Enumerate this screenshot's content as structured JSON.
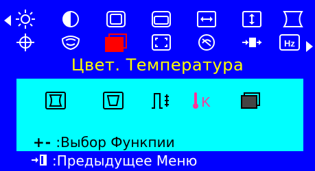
{
  "menu": {
    "row1_icons": [
      "brightness-icon",
      "contrast-icon",
      "h-size-icon",
      "v-size-icon",
      "h-position-icon",
      "v-position-icon",
      "pincushion-icon"
    ],
    "row2_icons": [
      "rotation-icon",
      "moire-icon",
      "color-temperature-icon",
      "zoom-icon",
      "degauss-icon",
      "input-source-icon",
      "frequency-icon"
    ],
    "selected": "color-temperature-icon",
    "frequency_label": "Hz"
  },
  "title": "Цвет. Температура",
  "panel": {
    "sub_icons": [
      "pincushion-sub-icon",
      "trapezoid-sub-icon",
      "parallelogram-sub-icon",
      "temperature-k-sub-icon",
      "color-adjust-sub-icon"
    ],
    "k_label": "K",
    "hint_keys": "+-",
    "hint_separator": ":",
    "hint_text": "Выбор Функпии"
  },
  "footer": {
    "separator": ":",
    "text": "Предыдущее Меню"
  },
  "colors": {
    "background": "#0000FF",
    "panel": "#00FFFF",
    "title": "#FFFF00",
    "selected": "#FF0000",
    "icon": "#FFFFFF"
  }
}
